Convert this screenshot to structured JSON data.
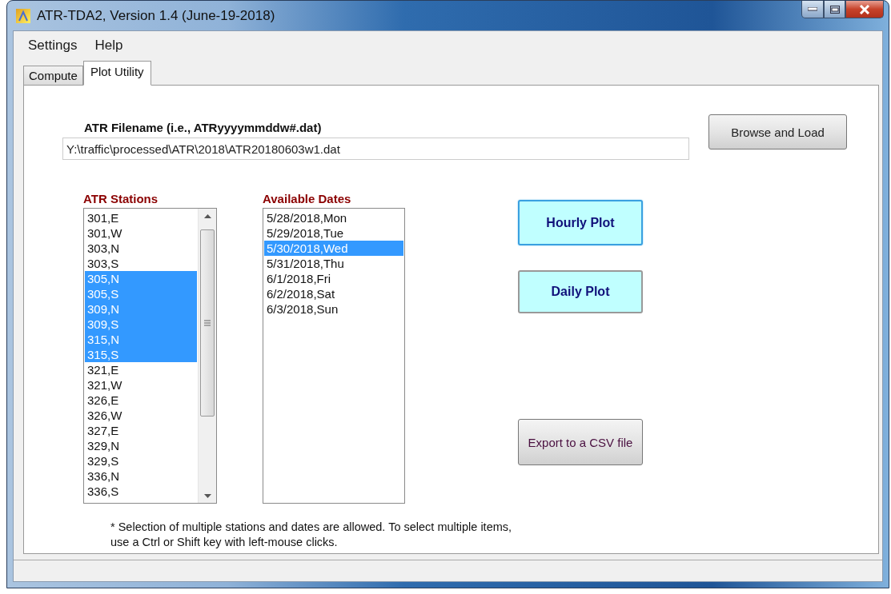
{
  "window": {
    "title": "ATR-TDA2, Version 1.4 (June-19-2018)"
  },
  "menu": [
    "Settings",
    "Help"
  ],
  "tabs": [
    {
      "label": "Compute",
      "selected": false
    },
    {
      "label": "Plot Utility",
      "selected": true
    }
  ],
  "filename": {
    "label": "ATR Filename (i.e., ATRyyyymmddw#.dat)",
    "value": "Y:\\traffic\\processed\\ATR\\2018\\ATR20180603w1.dat",
    "button": "Browse and Load"
  },
  "stations": {
    "label": "ATR Stations",
    "items": [
      {
        "text": "301,E",
        "selected": false
      },
      {
        "text": "301,W",
        "selected": false
      },
      {
        "text": "303,N",
        "selected": false
      },
      {
        "text": "303,S",
        "selected": false
      },
      {
        "text": "305,N",
        "selected": true
      },
      {
        "text": "305,S",
        "selected": true
      },
      {
        "text": "309,N",
        "selected": true
      },
      {
        "text": "309,S",
        "selected": true
      },
      {
        "text": "315,N",
        "selected": true
      },
      {
        "text": "315,S",
        "selected": true
      },
      {
        "text": "321,E",
        "selected": false
      },
      {
        "text": "321,W",
        "selected": false
      },
      {
        "text": "326,E",
        "selected": false
      },
      {
        "text": "326,W",
        "selected": false
      },
      {
        "text": "327,E",
        "selected": false
      },
      {
        "text": "329,N",
        "selected": false
      },
      {
        "text": "329,S",
        "selected": false
      },
      {
        "text": "336,N",
        "selected": false
      },
      {
        "text": "336,S",
        "selected": false
      }
    ]
  },
  "dates": {
    "label": "Available Dates",
    "items": [
      {
        "text": "5/28/2018,Mon",
        "selected": false
      },
      {
        "text": "5/29/2018,Tue",
        "selected": false
      },
      {
        "text": "5/30/2018,Wed",
        "selected": true
      },
      {
        "text": "5/31/2018,Thu",
        "selected": false
      },
      {
        "text": "6/1/2018,Fri",
        "selected": false
      },
      {
        "text": "6/2/2018,Sat",
        "selected": false
      },
      {
        "text": "6/3/2018,Sun",
        "selected": false
      }
    ]
  },
  "actions": [
    {
      "label": "Hourly Plot",
      "kind": "plot",
      "focused": true
    },
    {
      "label": "Daily Plot",
      "kind": "plot",
      "focused": false
    },
    {
      "label": "Export to a CSV file",
      "kind": "export",
      "focused": false
    }
  ],
  "note": "* Selection of multiple stations and dates are allowed. To select multiple items, use a Ctrl or Shift key with left-mouse clicks."
}
